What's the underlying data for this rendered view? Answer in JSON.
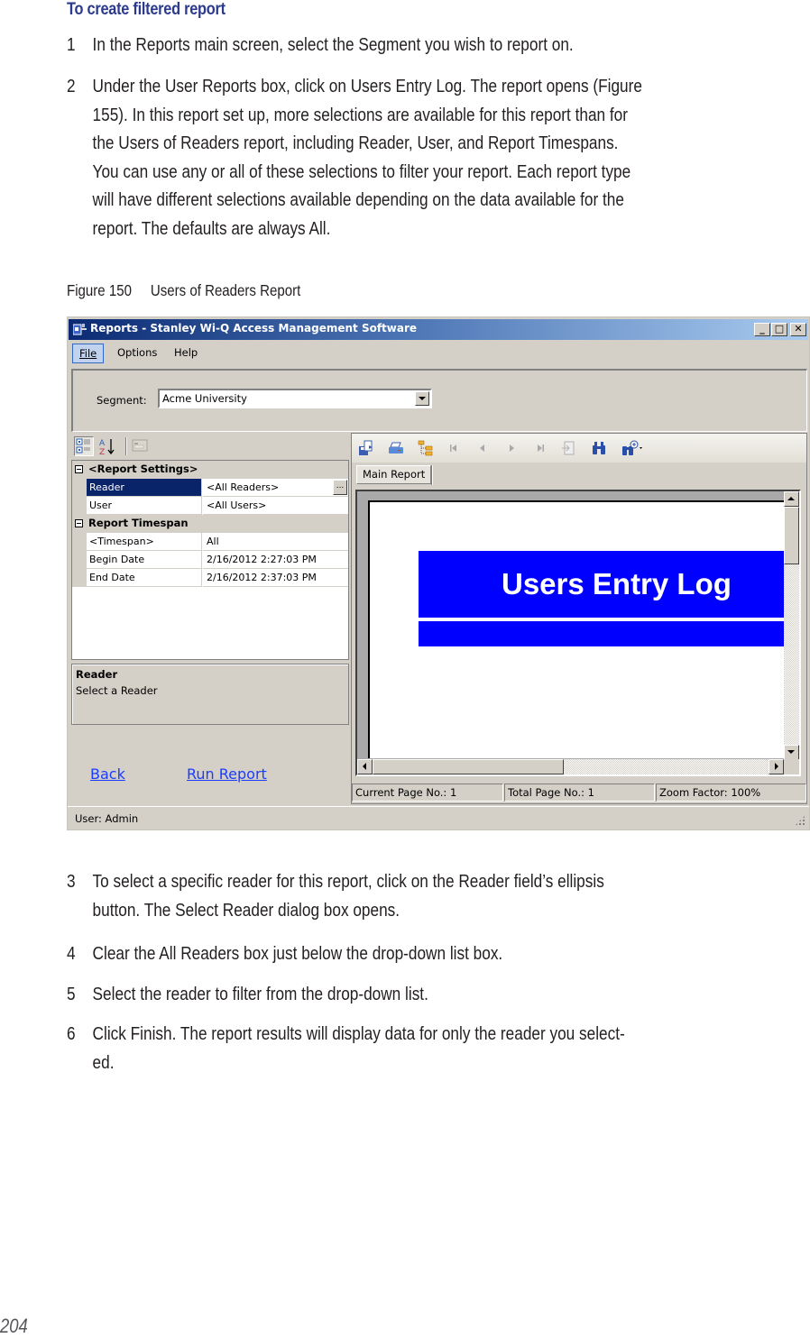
{
  "document": {
    "heading": "To create filtered report",
    "steps_before": [
      {
        "num": "1",
        "text": "In the Reports main screen, select the Segment you wish to report on."
      },
      {
        "num": "2",
        "text": "Under the User Reports box, click on Users Entry Log. The report opens (Figure\n155). In this report set up, more selections are available for this report than for\nthe Users of Readers report, including Reader, User, and Report Timespans.\nYou can use any or all of these selections to filter your report. Each report type\nwill have different selections available depending on the data available for the\nreport. The defaults are always All."
      }
    ],
    "figure_caption": "Figure 150     Users of Readers Report",
    "steps_after": [
      {
        "num": "3",
        "text": "To select a specific reader for this report, click on the Reader field’s  ellipsis\nbutton. The Select Reader dialog box opens."
      },
      {
        "num": "4",
        "text": "Clear the All Readers box just below the drop-down list box."
      },
      {
        "num": "5",
        "text": "Select the reader to filter from the drop-down list."
      },
      {
        "num": "6",
        "text": "Click Finish. The report results will display data for only the reader you select-\ned."
      }
    ],
    "page_number": "204"
  },
  "window": {
    "title": "Reports - Stanley Wi-Q Access Management Software",
    "caption_buttons": {
      "minimize": "_",
      "maximize": "□",
      "close": "✕"
    },
    "menu": [
      {
        "label": "File",
        "mnemonic": "F"
      },
      {
        "label": "Options",
        "mnemonic": "O"
      },
      {
        "label": "Help",
        "mnemonic": "H"
      }
    ],
    "segment": {
      "label": "Segment:",
      "value": "Acme University"
    },
    "property_grid": {
      "toolbar_icons": [
        "categorized-icon",
        "alphabetical-sort-icon",
        "property-pages-icon"
      ],
      "categories": [
        {
          "label": "<Report Settings>",
          "rows": [
            {
              "name": "Reader",
              "value": "<All Readers>",
              "selected": true
            },
            {
              "name": "User",
              "value": "<All Users>",
              "selected": false
            }
          ]
        },
        {
          "label": "Report Timespan",
          "rows": [
            {
              "name": "<Timespan>",
              "value": "All",
              "selected": false
            },
            {
              "name": "Begin Date",
              "value": "2/16/2012 2:27:03 PM",
              "selected": false
            },
            {
              "name": "End Date",
              "value": "2/16/2012 2:37:03 PM",
              "selected": false
            }
          ]
        }
      ],
      "ellipsis_label": "...",
      "help_title": "Reader",
      "help_description": "Select a Reader"
    },
    "links": {
      "back": "Back",
      "run_report": "Run Report"
    },
    "viewer": {
      "toolbar_icons": [
        "export-icon",
        "print-icon",
        "group-tree-icon",
        "first-page-icon",
        "previous-page-icon",
        "next-page-icon",
        "last-page-icon",
        "goto-page-icon",
        "search-icon",
        "zoom-icon"
      ],
      "tab_label": "Main Report",
      "report_title": "Users Entry Log",
      "status": {
        "current_page": "Current Page No.: 1",
        "total_page": "Total Page No.: 1",
        "zoom": "Zoom Factor: 100%"
      }
    },
    "status_user": "User: Admin"
  },
  "colors": {
    "heading": "#2b3a8c",
    "banner": "#0000ff",
    "selection": "#0a246a",
    "link": "#1a3cff",
    "window_bg": "#d4d0c8"
  }
}
